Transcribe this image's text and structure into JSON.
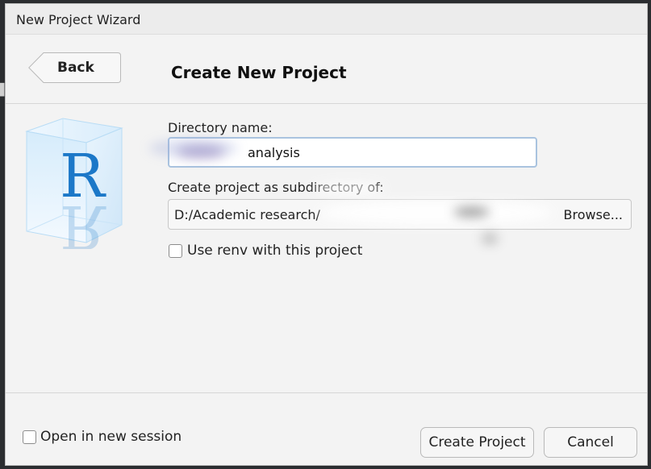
{
  "window": {
    "title": "New Project Wizard"
  },
  "header": {
    "back_label": "Back",
    "page_title": "Create New Project"
  },
  "form": {
    "directory_label": "Directory name:",
    "directory_value": "analysis",
    "parent_label": "Create project as subdirectory of:",
    "parent_path": "D:/Academic research/",
    "browse_label": "Browse...",
    "renv_label": "Use renv with this project",
    "renv_checked": false
  },
  "footer": {
    "new_session_label": "Open in new session",
    "new_session_checked": false,
    "create_label": "Create Project",
    "cancel_label": "Cancel"
  },
  "logo": {
    "letter": "R",
    "name": "r-cube-logo",
    "color": "#1c78c8"
  }
}
